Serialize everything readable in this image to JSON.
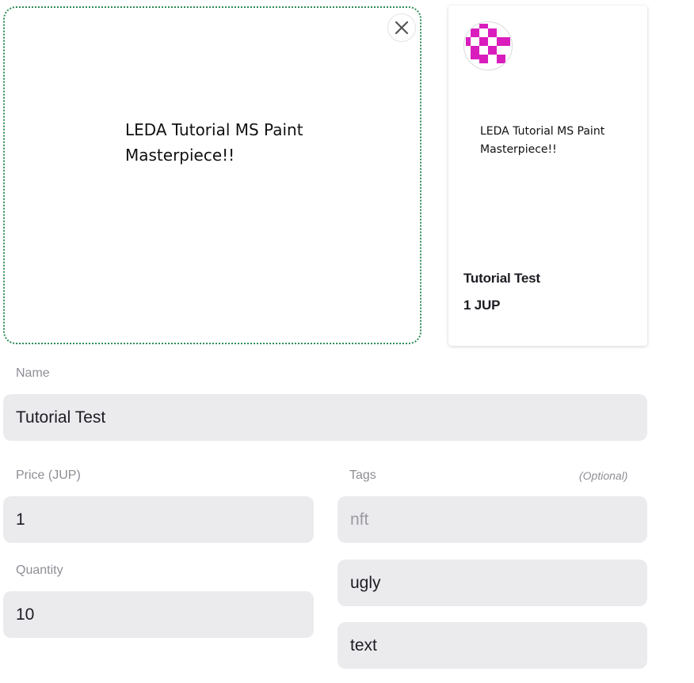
{
  "upload": {
    "image_text": "LEDA Tutorial MS Paint\nMasterpiece!!",
    "close_icon": "close-icon"
  },
  "preview_card": {
    "avatar_icon": "pixel-avatar",
    "image_text": "LEDA Tutorial MS Paint\nMasterpiece!!",
    "title": "Tutorial Test",
    "price": "1 JUP"
  },
  "form": {
    "name": {
      "label": "Name",
      "value": "Tutorial Test"
    },
    "price": {
      "label": "Price (JUP)",
      "value": "1"
    },
    "quantity": {
      "label": "Quantity",
      "value": "10"
    },
    "tags": {
      "label": "Tags",
      "optional_label": "(Optional)",
      "items": [
        {
          "value": "nft",
          "is_placeholder": true
        },
        {
          "value": "ugly",
          "is_placeholder": false
        },
        {
          "value": "text",
          "is_placeholder": false
        }
      ]
    }
  },
  "colors": {
    "dropzone_border": "#2e8b57",
    "field_background": "#ebebee",
    "avatar_accent": "#d91ebd"
  }
}
